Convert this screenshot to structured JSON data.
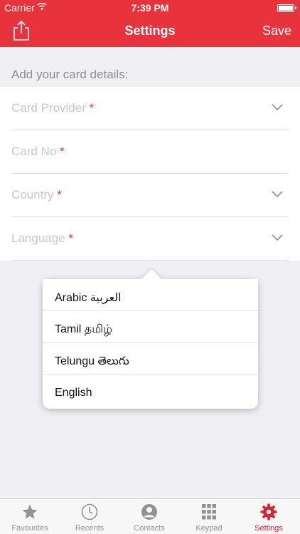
{
  "status_bar": {
    "carrier": "Carrier",
    "time": "7:39 PM"
  },
  "nav": {
    "title": "Settings",
    "save_label": "Save"
  },
  "section_header": "Add your card details:",
  "fields": [
    {
      "label": "Card Provider",
      "required": "*"
    },
    {
      "label": "Card No",
      "required": "*"
    },
    {
      "label": "Country",
      "required": "*"
    },
    {
      "label": "Language",
      "required": "*"
    }
  ],
  "language_options": [
    {
      "label": "Arabic العربية"
    },
    {
      "label": "Tamil தமிழ்"
    },
    {
      "label": "Telungu తెలుగు"
    },
    {
      "label": "English"
    }
  ],
  "tabs": [
    {
      "label": "Favourites",
      "icon": "star-icon"
    },
    {
      "label": "Recents",
      "icon": "clock-icon"
    },
    {
      "label": "Contacts",
      "icon": "contact-icon"
    },
    {
      "label": "Keypad",
      "icon": "keypad-icon"
    },
    {
      "label": "Settings",
      "icon": "gear-icon",
      "active": true
    }
  ],
  "colors": {
    "accent": "#e8323c",
    "tab_active": "#d9232d",
    "tab_inactive": "#929292"
  }
}
